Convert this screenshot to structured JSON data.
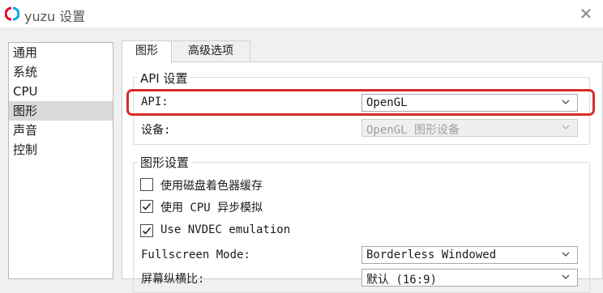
{
  "window": {
    "title": "yuzu 设置",
    "close_glyph": "✕"
  },
  "sidebar": {
    "items": [
      {
        "label": "通用",
        "selected": false
      },
      {
        "label": "系统",
        "selected": false
      },
      {
        "label": "CPU",
        "selected": false
      },
      {
        "label": "图形",
        "selected": true
      },
      {
        "label": "声音",
        "selected": false
      },
      {
        "label": "控制",
        "selected": false
      }
    ]
  },
  "tabs": [
    {
      "label": "图形",
      "active": true
    },
    {
      "label": "高级选项",
      "active": false
    }
  ],
  "api_group": {
    "title": "API 设置",
    "api_label": "API:",
    "api_value": "OpenGL",
    "device_label": "设备:",
    "device_value": "OpenGL 图形设备"
  },
  "graphics_group": {
    "title": "图形设置",
    "checkboxes": [
      {
        "label": "使用磁盘着色器缓存",
        "checked": false
      },
      {
        "label": "使用 CPU 异步模拟",
        "checked": true
      },
      {
        "label": "Use NVDEC emulation",
        "checked": true
      }
    ],
    "fullscreen_label": "Fullscreen Mode:",
    "fullscreen_value": "Borderless Windowed",
    "aspect_label": "屏幕纵横比:",
    "aspect_value": "默认 (16:9)"
  },
  "colors": {
    "highlight": "#d92b2b",
    "selection": "#d9d9d9",
    "brand_red": "#e4002b",
    "brand_blue": "#00a8e8"
  },
  "icons": {
    "app": "yuzu-logo-icon",
    "close": "close-icon",
    "dropdown": "chevron-down-icon",
    "check": "checkmark-icon"
  }
}
